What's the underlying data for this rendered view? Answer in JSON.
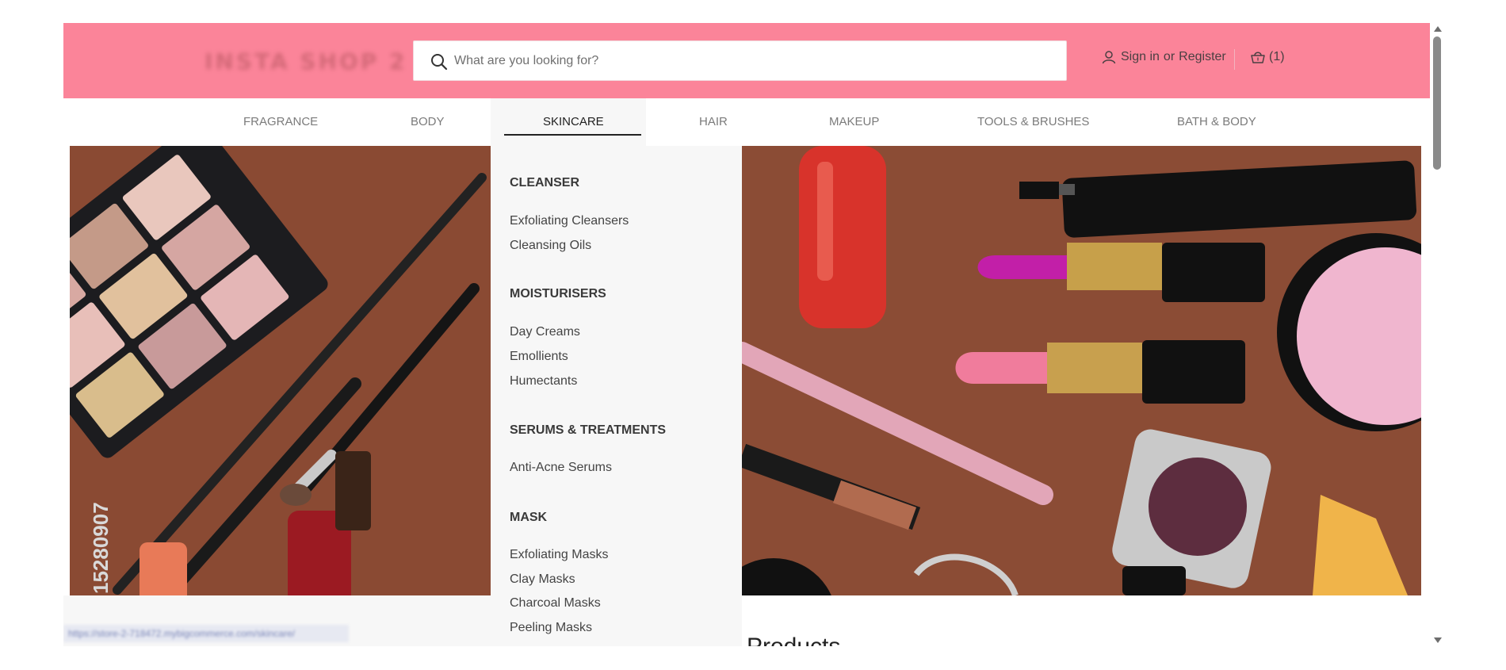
{
  "header": {
    "logo_text": "INSTA SHOP 2",
    "search": {
      "placeholder": "What are you looking for?",
      "value": ""
    },
    "account": {
      "sign_in": "Sign in",
      "or": "or",
      "register": "Register"
    },
    "cart": {
      "count": "(1)"
    },
    "colors": {
      "header_bg": "#fb8499",
      "text": "#4a3f42"
    }
  },
  "nav": {
    "items": [
      {
        "label": "FRAGRANCE"
      },
      {
        "label": "BODY"
      },
      {
        "label": "SKINCARE",
        "active": true
      },
      {
        "label": "HAIR"
      },
      {
        "label": "MAKEUP"
      },
      {
        "label": "TOOLS & BRUSHES"
      },
      {
        "label": "BATH & BODY"
      }
    ]
  },
  "dropdown": {
    "groups": [
      {
        "title": "CLEANSER",
        "links": [
          "Exfoliating Cleansers",
          "Cleansing Oils"
        ]
      },
      {
        "title": "MOISTURISERS",
        "links": [
          "Day Creams",
          "Emollients",
          "Humectants"
        ]
      },
      {
        "title": "SERUMS & TREATMENTS",
        "links": [
          "Anti-Acne Serums"
        ]
      },
      {
        "title": "MASK",
        "links": [
          "Exfoliating Masks",
          "Clay Masks",
          "Charcoal Masks",
          "Peeling Masks"
        ]
      }
    ]
  },
  "images": {
    "left": {
      "alt": "Makeup palette and brushes",
      "watermark_id": "15280907"
    },
    "right": {
      "alt": "Lipsticks, nail polish and cosmetics"
    }
  },
  "footer": {
    "status_url": "https://store-2-718472.mybigcommerce.com/skincare/",
    "products_heading": "Products"
  }
}
